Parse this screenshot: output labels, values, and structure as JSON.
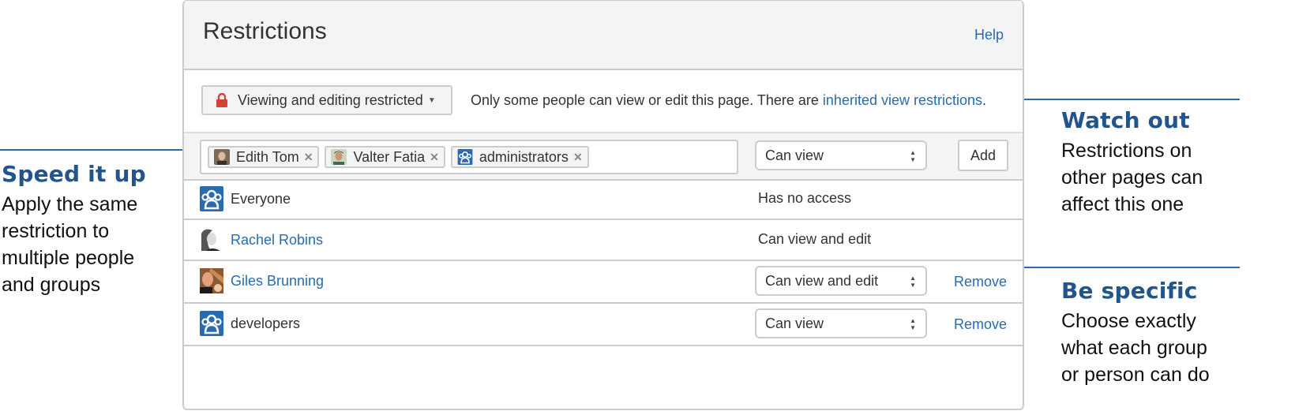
{
  "dialog": {
    "title": "Restrictions",
    "help_label": "Help",
    "restriction_mode": "Viewing and editing restricted",
    "info_prefix": "Only some people can view or edit this page. There are ",
    "info_link": "inherited view restrictions",
    "info_suffix": "."
  },
  "add_row": {
    "tokens": [
      {
        "label": "Edith Tom",
        "type": "user"
      },
      {
        "label": "Valter Fatia",
        "type": "user"
      },
      {
        "label": "administrators",
        "type": "group"
      }
    ],
    "permission": "Can view",
    "add_label": "Add"
  },
  "entries": [
    {
      "name": "Everyone",
      "type": "group",
      "permission": "Has no access",
      "editable": false
    },
    {
      "name": "Rachel Robins",
      "type": "user",
      "permission": "Can view and edit",
      "editable": false
    },
    {
      "name": "Giles Brunning",
      "type": "user",
      "permission": "Can view and edit",
      "editable": true,
      "remove_label": "Remove"
    },
    {
      "name": "developers",
      "type": "group",
      "permission": "Can view",
      "editable": true,
      "remove_label": "Remove"
    }
  ],
  "callouts": {
    "speed": {
      "title": "Speed it up",
      "body": [
        "Apply the same",
        "restriction to",
        "multiple people",
        "and groups"
      ]
    },
    "watch": {
      "title": "Watch out",
      "body": [
        "Restrictions on",
        "other pages can",
        "affect this one"
      ]
    },
    "specific": {
      "title": "Be specific",
      "body": [
        "Choose exactly",
        "what each group",
        "or person can do"
      ]
    }
  },
  "colors": {
    "accent": "#2a6ab0",
    "callout_title": "#21558c",
    "lock": "#d04437"
  }
}
